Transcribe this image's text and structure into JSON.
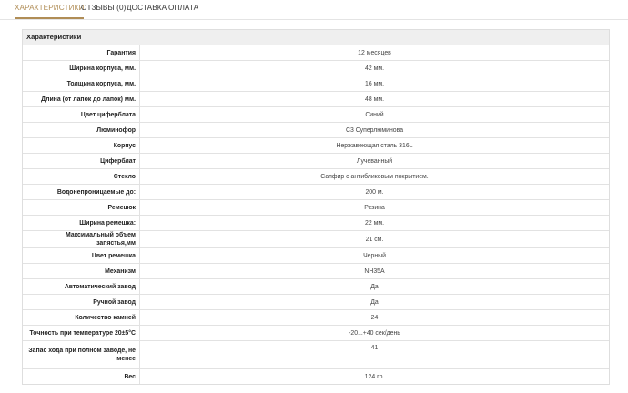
{
  "tabs": [
    {
      "label": "Характеристики",
      "active": true
    },
    {
      "label": "Отзывы (0)",
      "active": false
    },
    {
      "label": "Доставка",
      "active": false
    },
    {
      "label": "Оплата",
      "active": false
    }
  ],
  "spec": {
    "title": "Характеристики",
    "rows": [
      {
        "label": "Гарантия",
        "value": "12 месяцев"
      },
      {
        "label": "Ширина корпуса, мм.",
        "value": "42 мм."
      },
      {
        "label": "Толщина корпуса, мм.",
        "value": "16 мм."
      },
      {
        "label": "Длина (от лапок до лапок) мм.",
        "value": "48 мм."
      },
      {
        "label": "Цвет циферблата",
        "value": "Синий"
      },
      {
        "label": "Люминофор",
        "value": "C3 Суперлюминова"
      },
      {
        "label": "Корпус",
        "value": "Нержавеющая сталь 316L"
      },
      {
        "label": "Циферблат",
        "value": "Лучеванный"
      },
      {
        "label": "Стекло",
        "value": "Сапфир с антибликовым покрытием."
      },
      {
        "label": "Водонепроницаемые до:",
        "value": "200 м."
      },
      {
        "label": "Ремешок",
        "value": "Резина"
      },
      {
        "label": "Ширина ремешка:",
        "value": "22 мм."
      },
      {
        "label": "Максимальный объем запястья,мм",
        "value": "21 см."
      },
      {
        "label": "Цвет ремешка",
        "value": "Черный"
      },
      {
        "label": "Механизм",
        "value": "NH35A"
      },
      {
        "label": "Автоматический завод",
        "value": "Да"
      },
      {
        "label": "Ручной завод",
        "value": "Да"
      },
      {
        "label": "Количество камней",
        "value": "24"
      },
      {
        "label": "Точность при температуре 20±5°C",
        "value": "-20...+40 сек/день"
      },
      {
        "label": "Запас хода при полном заводе, не менее",
        "value": "41"
      },
      {
        "label": "Вес",
        "value": "124 гр."
      }
    ]
  }
}
